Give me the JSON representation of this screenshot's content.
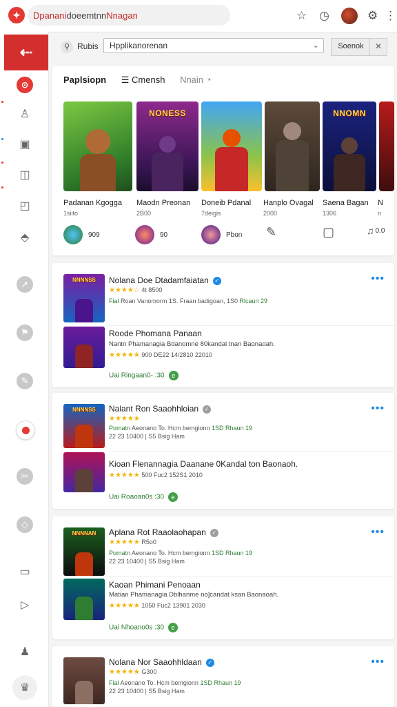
{
  "colors": {
    "accent": "#d32f2f",
    "link": "#1e88e5",
    "green": "#2e7d32",
    "star": "#f4b400"
  },
  "topbar": {
    "logo_icon": "brand-logo",
    "address_red": "Dpanani",
    "address_rest": " doeemtnn ",
    "address_end": "Nnagan",
    "icons": [
      "star-icon",
      "clock-icon",
      "avatar",
      "gear-icon",
      "more-vertical-icon"
    ],
    "icon_glyphs": {
      "star": "☆",
      "clock": "◷",
      "gear": "⚙",
      "kebab": "⋮"
    }
  },
  "sidebar": {
    "back_glyph": "⇠",
    "items": [
      {
        "name": "sidebar-item-home",
        "glyph": "⊙"
      },
      {
        "name": "sidebar-item-user",
        "glyph": "♙"
      },
      {
        "name": "sidebar-item-doc",
        "glyph": "▣"
      },
      {
        "name": "sidebar-item-monitor",
        "glyph": "◫"
      },
      {
        "name": "sidebar-item-stats",
        "glyph": "◰"
      },
      {
        "name": "sidebar-item-upload",
        "glyph": "⬘"
      },
      {
        "name": "sidebar-item-send",
        "glyph": "➚"
      },
      {
        "name": "sidebar-item-flag",
        "glyph": "⚑"
      },
      {
        "name": "sidebar-item-pin",
        "glyph": "✎"
      },
      {
        "name": "sidebar-item-record",
        "glyph": ""
      },
      {
        "name": "sidebar-item-share",
        "glyph": "✂"
      },
      {
        "name": "sidebar-item-compass",
        "glyph": "◇"
      },
      {
        "name": "sidebar-item-tv",
        "glyph": "▭"
      },
      {
        "name": "sidebar-item-play",
        "glyph": "▷"
      },
      {
        "name": "sidebar-item-profile",
        "glyph": "♟"
      },
      {
        "name": "sidebar-item-account",
        "glyph": "♛"
      }
    ]
  },
  "search": {
    "label": "Rubis",
    "icon": "search-icon",
    "value": "Hpplikanorenan",
    "button": "Soenok",
    "clear": "✕",
    "chevron": "⌄"
  },
  "featured": {
    "tabs": [
      {
        "label": "Paplsiopn",
        "style": "b"
      },
      {
        "label": "☰ Cmensh",
        "style": "m"
      },
      {
        "label": "Nnain ◔",
        "style": "g"
      }
    ],
    "cards": [
      {
        "name": "Padanan Kgogga",
        "sub": "1siito",
        "foot": "909",
        "art": ""
      },
      {
        "name": "Maodn Preonan",
        "sub": "2B00",
        "foot": "90",
        "art": "NONESS"
      },
      {
        "name": "Doneib Pdanal",
        "sub": "7deigis",
        "foot": "Pbon",
        "art": ""
      },
      {
        "name": "Hanplo Ovagal",
        "sub": "2000",
        "foot": "",
        "art": ""
      },
      {
        "name": "Saena Bagan",
        "sub": "1306",
        "foot": "",
        "art": "NNOMN"
      },
      {
        "name": "N",
        "sub": "n",
        "foot": "0.0",
        "art": ""
      }
    ]
  },
  "groups": [
    {
      "rows": [
        {
          "title": "Nolana Doe Dtadamfaiatan",
          "verified": true,
          "stars": "★★★★☆",
          "rating": "4t 8500",
          "meta_green": "Fial",
          "meta": "Roan Vanomorm 1S. Fraan badigoan, 1S0",
          "meta_green2": "Rlcaun 29",
          "art": "NNNNSS"
        },
        {
          "title": "Roode Phomana Panaan",
          "verified": false,
          "desc": "Nantn Phamanagia Bdanomne 80kandal tnan Baonaoah.",
          "stars": "★★★★★",
          "meta": "900 DE22 14/2810 22010",
          "link": "Uai Ringaan0- :30",
          "art": ""
        }
      ]
    },
    {
      "rows": [
        {
          "title": "Nalant Ron Saaohhloian",
          "verified": true,
          "stars": "★★★★★",
          "rating": "",
          "meta_green": "Pomatn",
          "meta": "Aeonano To. Hcm bemgionn",
          "meta_green2": "1SD Rhaun 19",
          "meta2": "22 23 10400 | S5 Bsig Ham",
          "art": "NNNNSS"
        },
        {
          "title": "Kioan Flenannagia Daanane 0Kandal ton Baonaoh.",
          "verified": false,
          "stars": "★★★★★",
          "meta": "500 Fuc2 152S1 2010",
          "link": "Uai Roaoan0s :30",
          "art": ""
        }
      ]
    },
    {
      "rows": [
        {
          "title": "Aplana Rot Raaolaohapan",
          "verified": true,
          "stars": "★★★★★",
          "rating": "R5o0",
          "meta_green": "Pomatn",
          "meta": "Aeonano To. Hcm bemgionn",
          "meta_green2": "1SD Rhaun 19",
          "meta2": "22 23 10400 | S5 Bsig Ham",
          "art": "NNNNAN"
        },
        {
          "title": "Kaoan Phimani Penoaan",
          "verified": false,
          "desc": "Matian Phamanagia Dblhanme no]candat ksan Baonaoah.",
          "stars": "★★★★★",
          "meta": "1050 Fuc2 13901 2030",
          "link": "Uai Nhoano0s :30",
          "art": ""
        }
      ]
    },
    {
      "rows": [
        {
          "title": "Nolana Nor Saaohhldaan",
          "verified": true,
          "stars": "★★★★★",
          "rating": "G300",
          "meta_green": "Fial",
          "meta": "Aeonano To. Hcm bemgionn",
          "meta_green2": "1SD Rhaun 19",
          "meta2": "22 23 10400 | S5 Bsig Ham",
          "art": ""
        }
      ]
    }
  ]
}
